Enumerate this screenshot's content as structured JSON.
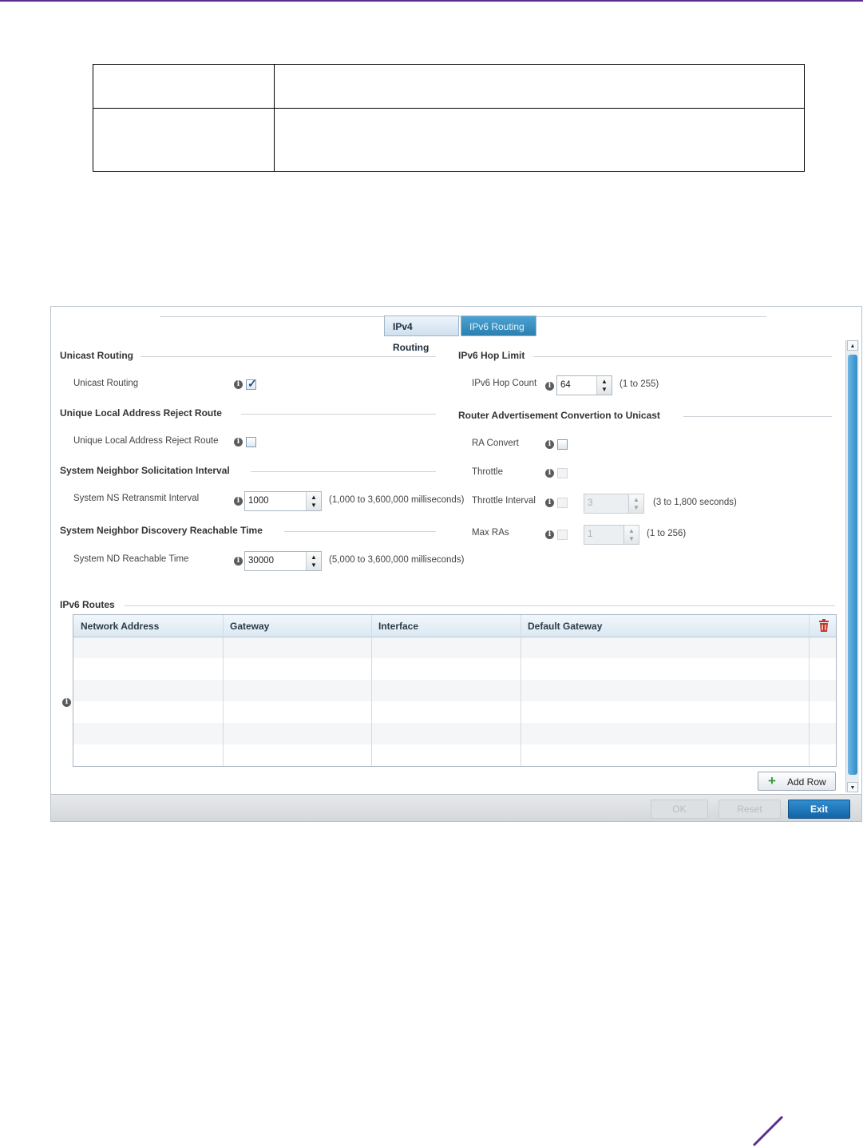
{
  "tabs": {
    "ipv4": "IPv4 Routing",
    "ipv6": "IPv6 Routing"
  },
  "unicast": {
    "title": "Unicast Routing",
    "label": "Unicast Routing",
    "checked": true
  },
  "ula": {
    "title": "Unique Local Address Reject Route",
    "label": "Unique Local Address Reject Route",
    "checked": false
  },
  "ns": {
    "title": "System Neighbor Solicitation Interval",
    "label": "System NS Retransmit Interval",
    "value": "1000",
    "hint": "(1,000 to 3,600,000 milliseconds)"
  },
  "nd": {
    "title": "System Neighbor Discovery Reachable Time",
    "label": "System ND Reachable Time",
    "value": "30000",
    "hint": "(5,000 to 3,600,000 milliseconds)"
  },
  "hop": {
    "title": "IPv6 Hop Limit",
    "label": "IPv6 Hop Count",
    "value": "64",
    "hint": "(1 to 255)"
  },
  "ra": {
    "title": "Router Advertisement Convertion to Unicast",
    "convert_label": "RA Convert",
    "throttle_label": "Throttle",
    "interval_label": "Throttle Interval",
    "interval_value": "3",
    "interval_hint": "(3 to 1,800 seconds)",
    "maxras_label": "Max RAs",
    "maxras_value": "1",
    "maxras_hint": "(1 to 256)"
  },
  "routes": {
    "title": "IPv6 Routes",
    "columns": [
      "Network Address",
      "Gateway",
      "Interface",
      "Default Gateway"
    ],
    "add_row": "Add Row"
  },
  "footer": {
    "ok": "OK",
    "reset": "Reset",
    "exit": "Exit"
  },
  "colors": {
    "accent": "#5b2d8e",
    "tab_active": "#2b7fb1",
    "exit": "#1463a5"
  }
}
